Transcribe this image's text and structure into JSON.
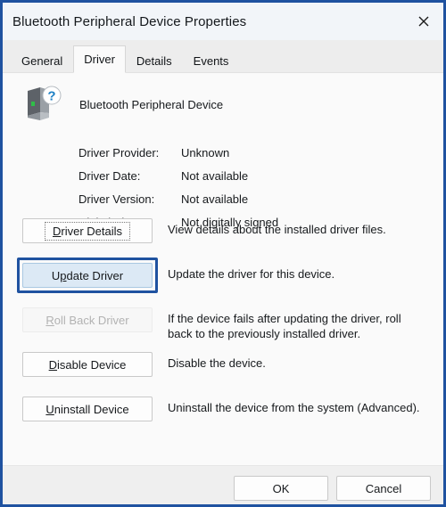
{
  "window": {
    "title": "Bluetooth Peripheral Device Properties",
    "close_icon": "close-icon",
    "border_color": "#1f52a0"
  },
  "tabs": [
    {
      "label": "General",
      "selected": false
    },
    {
      "label": "Driver",
      "selected": true
    },
    {
      "label": "Details",
      "selected": false
    },
    {
      "label": "Events",
      "selected": false
    }
  ],
  "device": {
    "icon": "unknown-device-icon",
    "name": "Bluetooth Peripheral Device"
  },
  "driver_info": [
    {
      "label": "Driver Provider:",
      "value": "Unknown"
    },
    {
      "label": "Driver Date:",
      "value": "Not available"
    },
    {
      "label": "Driver Version:",
      "value": "Not available"
    },
    {
      "label": "Digital Signer:",
      "value": "Not digitally signed"
    }
  ],
  "actions": [
    {
      "button": {
        "pre": "",
        "accel": "D",
        "post": "river Details"
      },
      "label": "Driver Details",
      "state": "focus-rect",
      "description": "View details about the installed driver files."
    },
    {
      "button": {
        "pre": "U",
        "accel": "p",
        "post": "date Driver"
      },
      "label": "Update Driver",
      "state": "focused",
      "description": "Update the driver for this device."
    },
    {
      "button": {
        "pre": "",
        "accel": "R",
        "post": "oll Back Driver"
      },
      "label": "Roll Back Driver",
      "state": "disabled",
      "description": "If the device fails after updating the driver, roll back to the previously installed driver."
    },
    {
      "button": {
        "pre": "",
        "accel": "D",
        "post": "isable Device"
      },
      "label": "Disable Device",
      "state": "normal",
      "description": "Disable the device."
    },
    {
      "button": {
        "pre": "",
        "accel": "U",
        "post": "ninstall Device"
      },
      "label": "Uninstall Device",
      "state": "normal",
      "description": "Uninstall the device from the system (Advanced)."
    }
  ],
  "footer": {
    "ok_label": "OK",
    "cancel_label": "Cancel"
  }
}
